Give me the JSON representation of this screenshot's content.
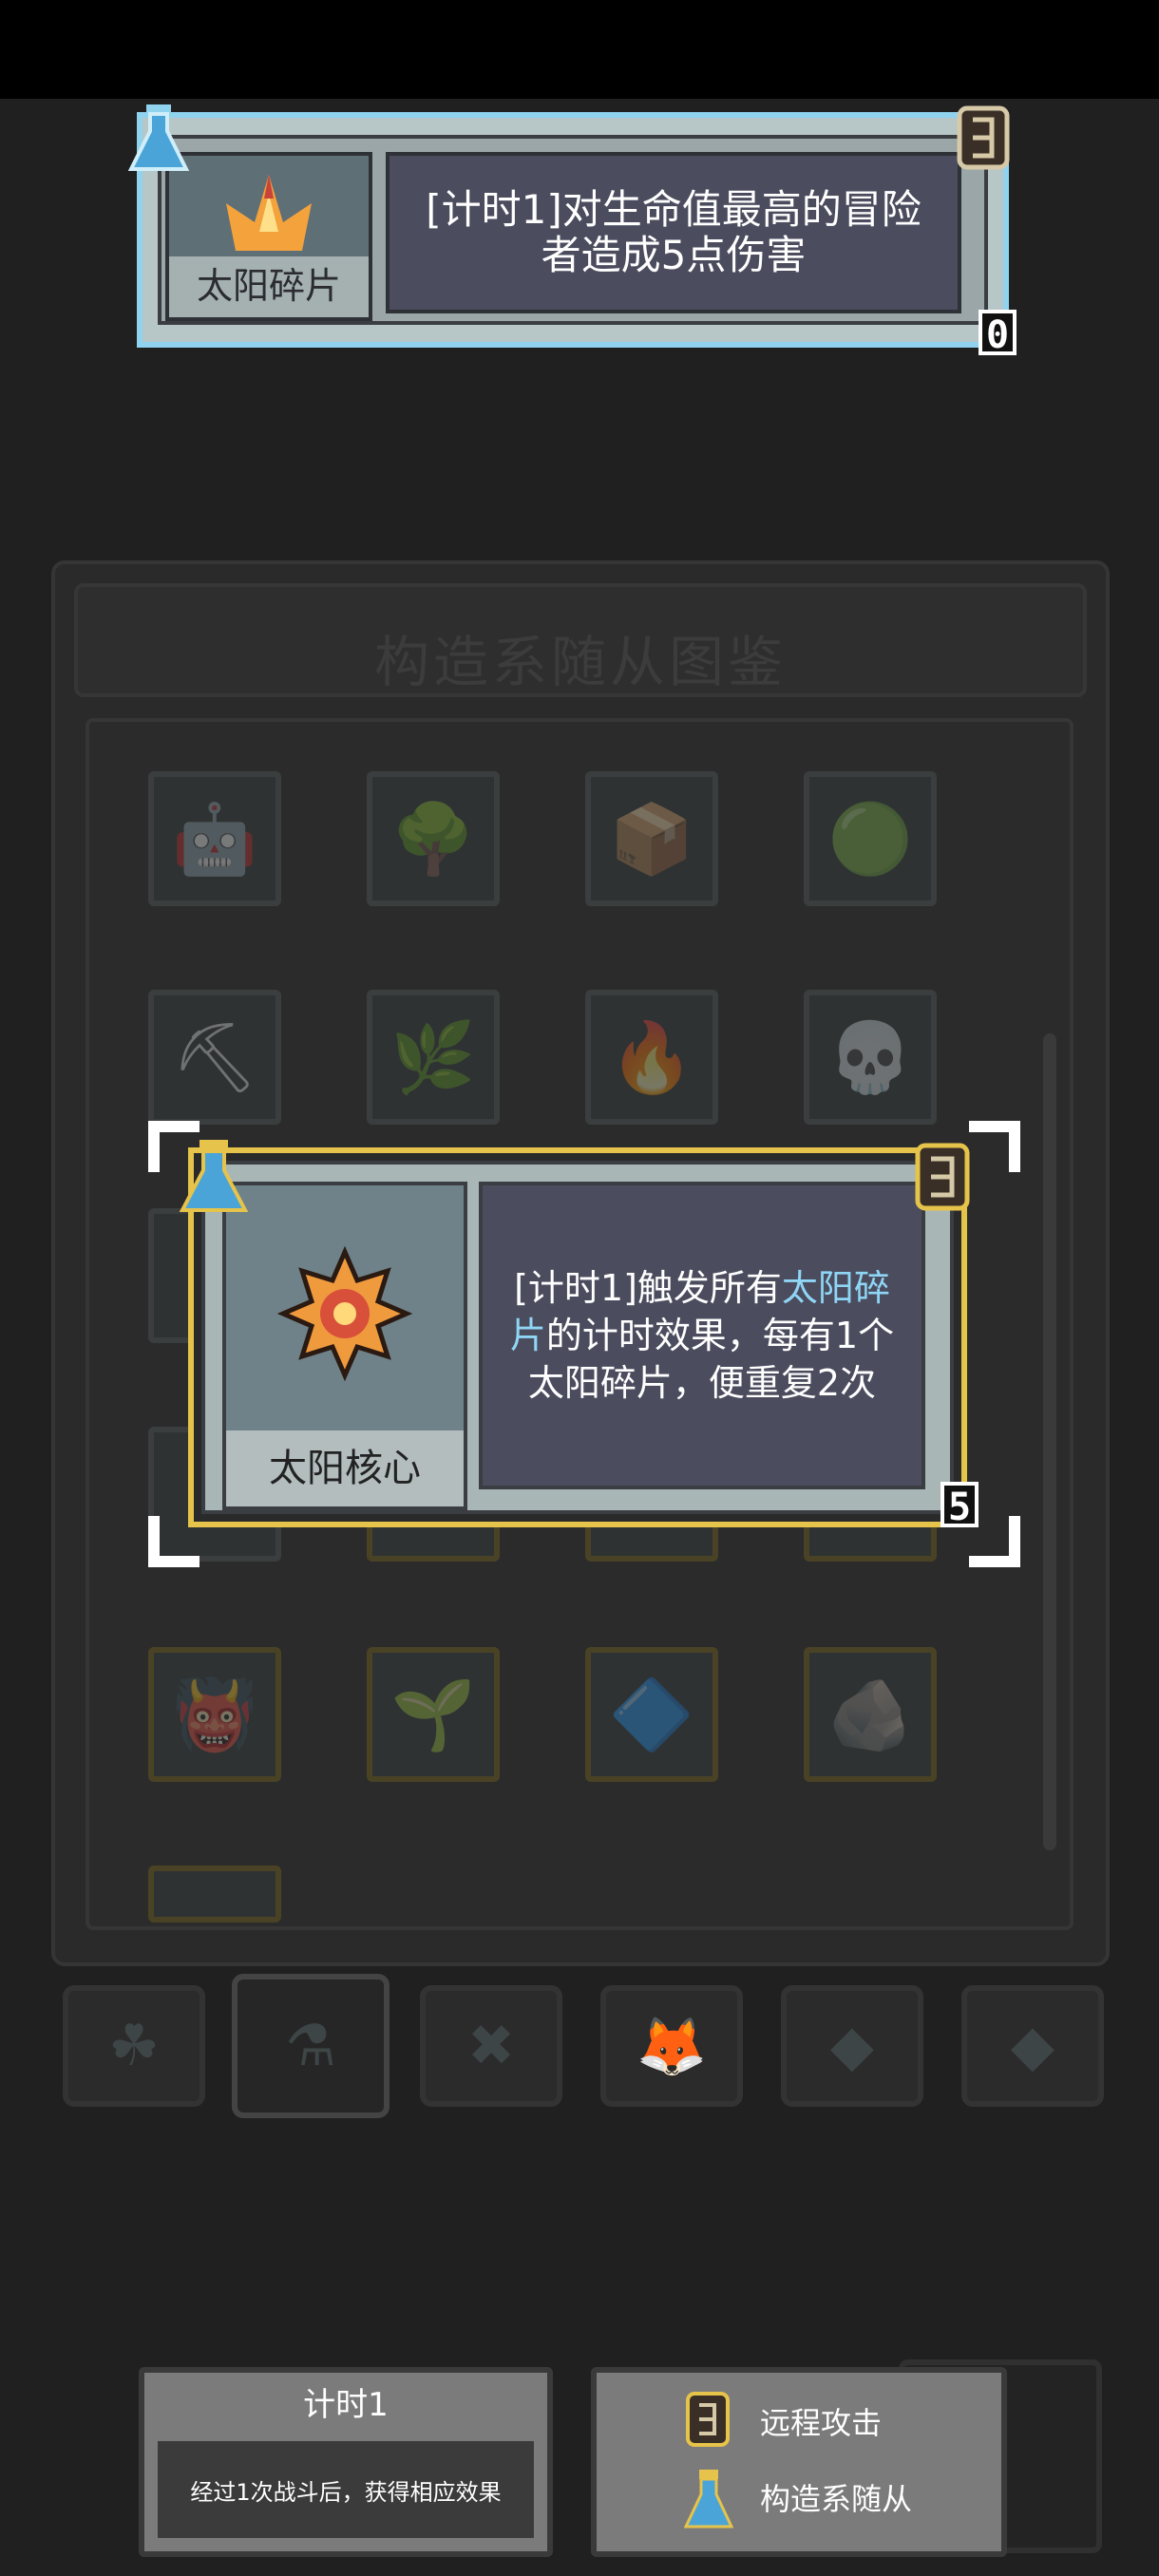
{
  "top_card": {
    "name": "太阳碎片",
    "description": "[计时1]对生命值最高的冒险者造成5点伤害",
    "level": "0",
    "type_icon": "flask-icon",
    "attack_icon": "ranged-attack-icon"
  },
  "collection": {
    "title": "构造系随从图鉴"
  },
  "main_card": {
    "name": "太阳核心",
    "description_pre": "[计时1]触发所有",
    "description_highlight": "太阳碎片",
    "description_post": "的计时效果，每有1个太阳碎片，便重复2次",
    "level": "5",
    "type_icon": "flask-icon",
    "attack_icon": "ranged-attack-icon",
    "highlight_color": "#8fd6f5",
    "frame_color": "#e6c34a"
  },
  "tabs": [
    {
      "icon": "clover-icon"
    },
    {
      "icon": "flask-icon",
      "active": true
    },
    {
      "icon": "crossed-bones-icon"
    },
    {
      "icon": "fox-head-icon"
    },
    {
      "icon": "diamond-icon"
    },
    {
      "icon": "diamond-icon"
    }
  ],
  "info": {
    "keyword_title": "计时1",
    "keyword_desc": "经过1次战斗后，获得相应效果",
    "legend": [
      {
        "icon": "ranged-attack-icon",
        "label": "远程攻击"
      },
      {
        "icon": "flask-icon",
        "label": "构造系随从"
      }
    ]
  }
}
